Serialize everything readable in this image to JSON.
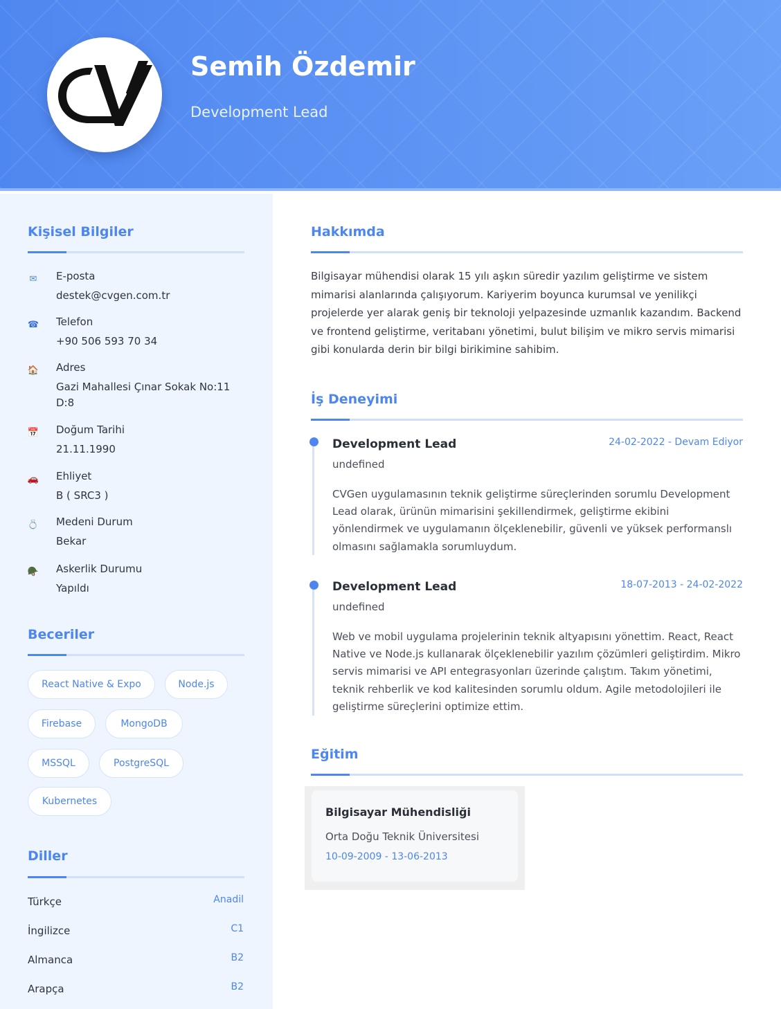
{
  "header": {
    "name": "Semih Özdemir",
    "title": "Development Lead",
    "logo_text": "CV",
    "accent_color": "#5a90f2"
  },
  "sidebar": {
    "personal": {
      "title": "Kişisel Bilgiler",
      "items": [
        {
          "icon": "envelope-icon",
          "glyph": "✉",
          "label": "E-posta",
          "value": "destek@cvgen.com.tr"
        },
        {
          "icon": "phone-icon",
          "glyph": "☎",
          "label": "Telefon",
          "value": "+90 506 593 70 34"
        },
        {
          "icon": "house-icon",
          "glyph": "🏠",
          "label": "Adres",
          "value": "Gazi Mahallesi Çınar Sokak No:11 D:8"
        },
        {
          "icon": "calendar-icon",
          "glyph": "📅",
          "label": "Doğum Tarihi",
          "value": "21.11.1990"
        },
        {
          "icon": "car-icon",
          "glyph": "🚗",
          "label": "Ehliyet",
          "value": "B ( SRC3 )"
        },
        {
          "icon": "ring-icon",
          "glyph": "💍",
          "label": "Medeni Durum",
          "value": "Bekar"
        },
        {
          "icon": "helmet-icon",
          "glyph": "🪖",
          "label": "Askerlik Durumu",
          "value": "Yapıldı"
        }
      ]
    },
    "skills": {
      "title": "Beceriler",
      "items": [
        "React Native & Expo",
        "Node.js",
        "Firebase",
        "MongoDB",
        "MSSQL",
        "PostgreSQL",
        "Kubernetes"
      ]
    },
    "languages": {
      "title": "Diller",
      "items": [
        {
          "name": "Türkçe",
          "level": "Anadil"
        },
        {
          "name": "İngilizce",
          "level": "C1"
        },
        {
          "name": "Almanca",
          "level": "B2"
        },
        {
          "name": "Arapça",
          "level": "B2"
        }
      ]
    }
  },
  "main": {
    "about": {
      "title": "Hakkımda",
      "text": "Bilgisayar mühendisi olarak 15 yılı aşkın süredir yazılım geliştirme ve sistem mimarisi alanlarında çalışıyorum. Kariyerim boyunca kurumsal ve yenilikçi projelerde yer alarak geniş bir teknoloji yelpazesinde uzmanlık kazandım. Backend ve frontend geliştirme, veritabanı yönetimi, bulut bilişim ve mikro servis mimarisi gibi konularda derin bir bilgi birikimine sahibim."
    },
    "experience": {
      "title": "İş Deneyimi",
      "jobs": [
        {
          "title": "Development Lead",
          "date": "24-02-2022 - Devam Ediyor",
          "company": "undefined",
          "description": "CVGen uygulamasının teknik geliştirme süreçlerinden sorumlu Development Lead olarak, ürünün mimarisini şekillendirmek, geliştirme ekibini yönlendirmek ve uygulamanın ölçeklenebilir, güvenli ve yüksek performanslı olmasını sağlamakla sorumluydum."
        },
        {
          "title": "Development Lead",
          "date": "18-07-2013 - 24-02-2022",
          "company": "undefined",
          "description": "Web ve mobil uygulama projelerinin teknik altyapısını yönettim. React, React Native ve Node.js kullanarak ölçeklenebilir yazılım çözümleri geliştirdim. Mikro servis mimarisi ve API entegrasyonları üzerinde çalıştım. Takım yönetimi, teknik rehberlik ve kod kalitesinden sorumlu oldum. Agile metodolojileri ile geliştirme süreçlerini optimize ettim."
        }
      ]
    },
    "education": {
      "title": "Eğitim",
      "items": [
        {
          "degree": "Bilgisayar Mühendisliği",
          "school": "Orta Doğu Teknik Üniversitesi",
          "date": "10-09-2009 - 13-06-2013"
        }
      ]
    }
  }
}
